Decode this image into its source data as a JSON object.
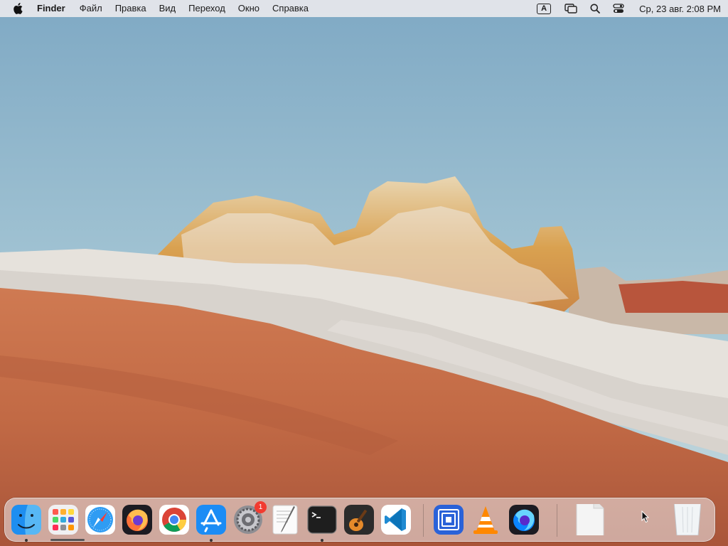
{
  "menubar": {
    "app_name": "Finder",
    "items": [
      "Файл",
      "Правка",
      "Вид",
      "Переход",
      "Окно",
      "Справка"
    ],
    "input_source": "A",
    "clock": "Ср, 23 авг.  2:08 PM"
  },
  "dock": {
    "apps": [
      {
        "name": "Finder",
        "icon": "finder-icon",
        "running": true
      },
      {
        "name": "Launchpad",
        "icon": "launchpad-icon",
        "running": false
      },
      {
        "name": "Safari",
        "icon": "safari-icon",
        "running": false
      },
      {
        "name": "Firefox",
        "icon": "firefox-icon",
        "running": false
      },
      {
        "name": "Google Chrome",
        "icon": "chrome-icon",
        "running": false
      },
      {
        "name": "App Store",
        "icon": "app-store-icon",
        "running": true
      },
      {
        "name": "System Settings",
        "icon": "settings-gear-icon",
        "running": false,
        "badge": "1"
      },
      {
        "name": "TextEdit",
        "icon": "textedit-icon",
        "running": false
      },
      {
        "name": "Terminal",
        "icon": "terminal-icon",
        "running": true
      },
      {
        "name": "GarageBand",
        "icon": "garageband-icon",
        "running": false
      },
      {
        "name": "Visual Studio Code",
        "icon": "vscode-icon",
        "running": false
      },
      {
        "name": "Screen Sharing",
        "icon": "screen-sharing-icon",
        "running": false
      },
      {
        "name": "VLC",
        "icon": "vlc-cone-icon",
        "running": false
      },
      {
        "name": "Firefox Developer Edition",
        "icon": "firefox-dev-icon",
        "running": false
      },
      {
        "name": "Document",
        "icon": "document-icon",
        "running": false
      },
      {
        "name": "Trash",
        "icon": "trash-icon",
        "running": false
      }
    ],
    "settings_badge": "1"
  },
  "colors": {
    "menubar_bg": "#e8e8ec",
    "sky_top": "#7fa9c4",
    "sand": "#c26a45",
    "badge_red": "#f23b30"
  }
}
